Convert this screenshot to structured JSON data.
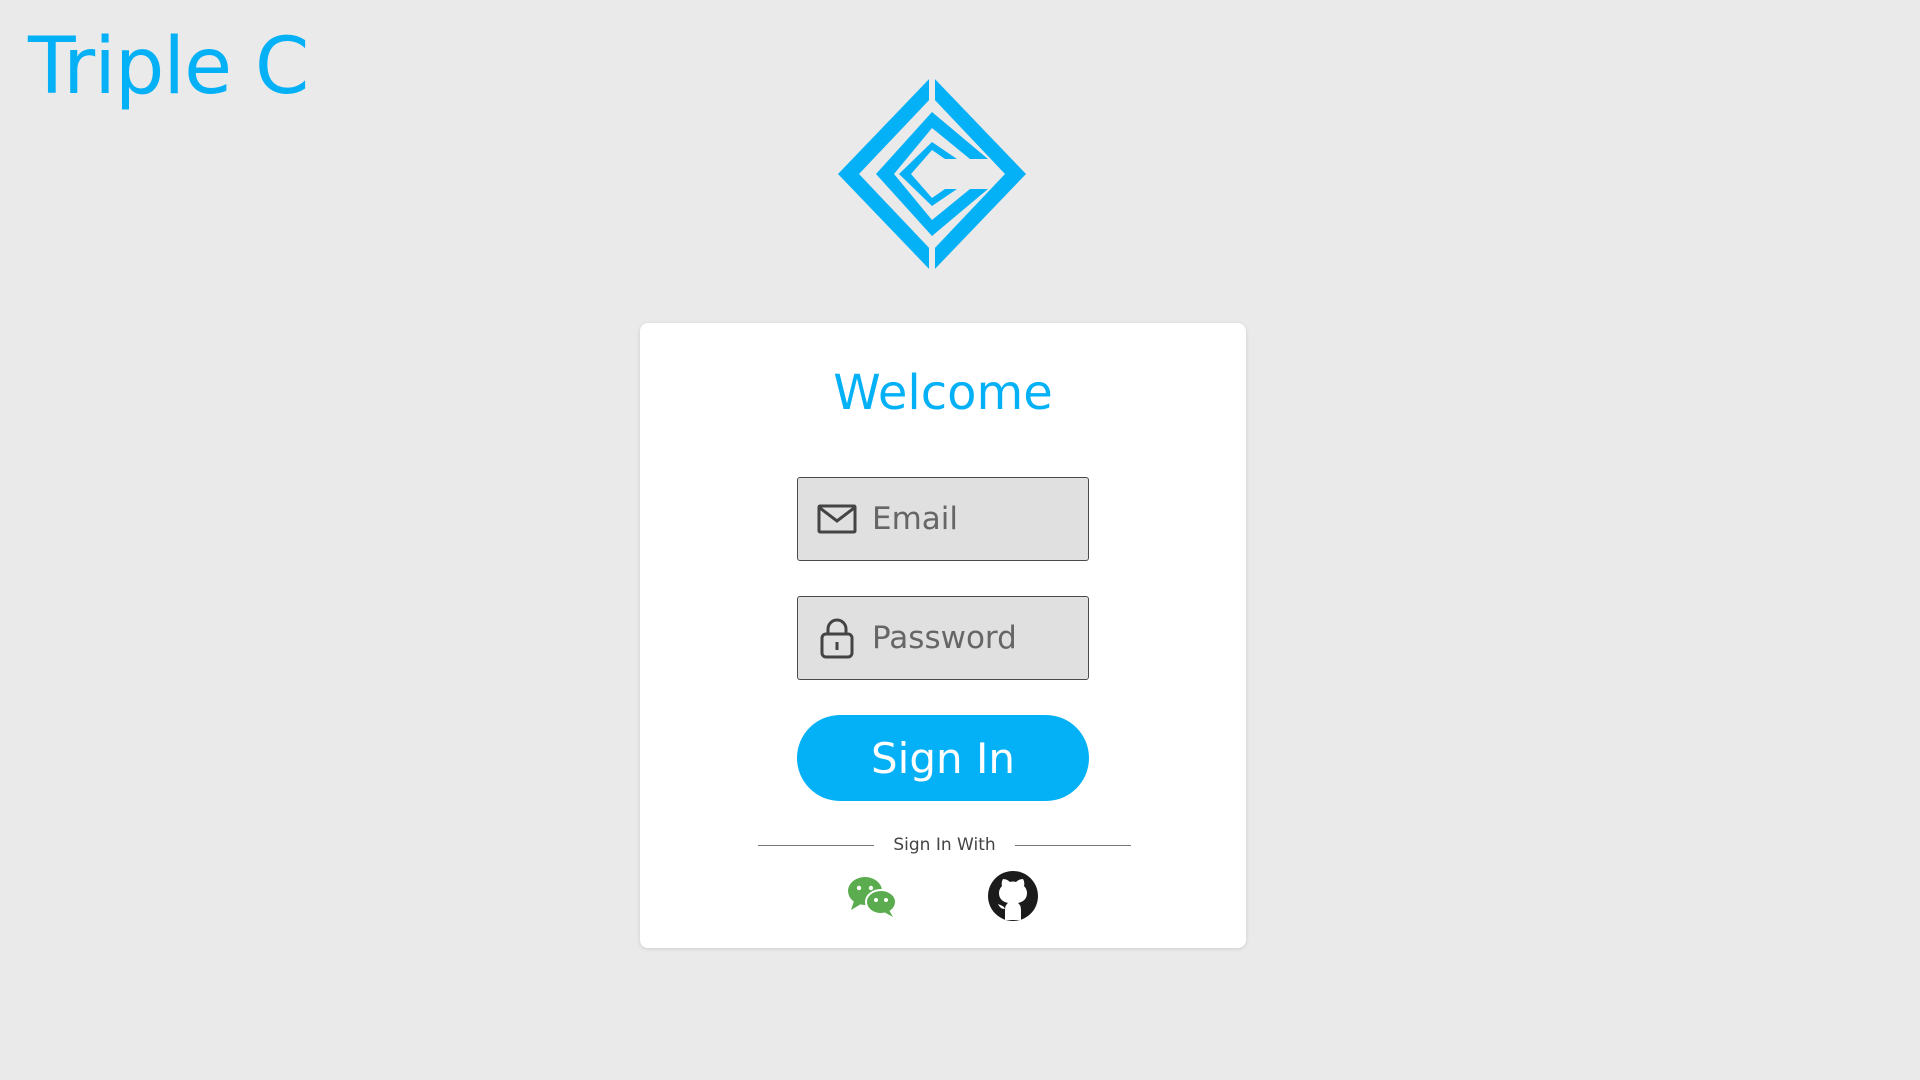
{
  "brand": {
    "title": "Triple C",
    "logo_icon": "triple-c-diamond-logo",
    "color": "#05b1f6"
  },
  "card": {
    "heading": "Welcome",
    "email": {
      "icon": "envelope-icon",
      "placeholder": "Email",
      "value": ""
    },
    "password": {
      "icon": "lock-icon",
      "placeholder": "Password",
      "value": ""
    },
    "submit_label": "Sign In",
    "divider_label": "Sign In With",
    "social_buttons": [
      {
        "name": "wechat",
        "icon": "wechat-icon",
        "color": "#5aac4e"
      },
      {
        "name": "github",
        "icon": "github-icon",
        "color": "#1b1b1b"
      }
    ]
  },
  "colors": {
    "accent": "#05b1f6",
    "background": "#eaeaea",
    "card": "#ffffff",
    "field_background": "#e0e0e0"
  }
}
